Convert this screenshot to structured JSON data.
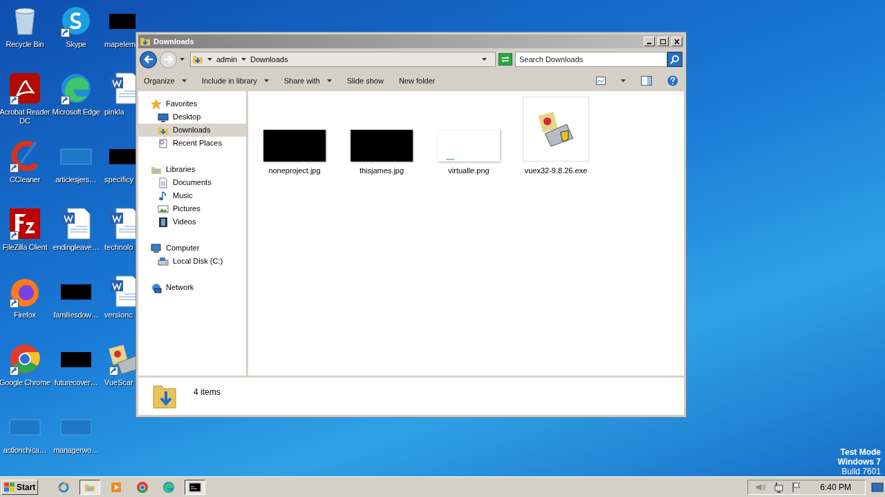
{
  "desktop": {
    "icons": [
      {
        "label": "Recycle Bin",
        "kind": "recycle",
        "shortcut": false
      },
      {
        "label": "Skype",
        "kind": "skype",
        "shortcut": true
      },
      {
        "label": "mapelem",
        "kind": "dark",
        "shortcut": false
      },
      {
        "label": "Acrobat Reader DC",
        "kind": "acrobat",
        "shortcut": true
      },
      {
        "label": "Microsoft Edge",
        "kind": "edge",
        "shortcut": true
      },
      {
        "label": "pinkla",
        "kind": "word",
        "shortcut": false
      },
      {
        "label": "CCleaner",
        "kind": "ccleaner",
        "shortcut": true
      },
      {
        "label": "articlesjers…",
        "kind": "blank",
        "shortcut": false
      },
      {
        "label": "specificy",
        "kind": "dark",
        "shortcut": false
      },
      {
        "label": "FileZilla Client",
        "kind": "filezilla",
        "shortcut": true
      },
      {
        "label": "endingleave…",
        "kind": "word",
        "shortcut": false
      },
      {
        "label": "technolo",
        "kind": "word",
        "shortcut": false
      },
      {
        "label": "Firefox",
        "kind": "firefox",
        "shortcut": true
      },
      {
        "label": "familiesdow…",
        "kind": "dark",
        "shortcut": false
      },
      {
        "label": "versionc",
        "kind": "word",
        "shortcut": false
      },
      {
        "label": "Google Chrome",
        "kind": "chrome",
        "shortcut": true
      },
      {
        "label": "futurecover…",
        "kind": "dark",
        "shortcut": false
      },
      {
        "label": "VueScar",
        "kind": "vuescan",
        "shortcut": true
      },
      {
        "label": "actionchica…",
        "kind": "blank",
        "shortcut": false
      },
      {
        "label": "managerwo…",
        "kind": "blank",
        "shortcut": false
      }
    ],
    "system_text": [
      "Test Mode",
      "Windows 7",
      "Build 7601"
    ]
  },
  "window": {
    "title": "Downloads",
    "breadcrumb": [
      "admin",
      "Downloads"
    ],
    "search": {
      "placeholder": "Search Downloads"
    },
    "toolbar": [
      {
        "label": "Organize",
        "dropdown": true
      },
      {
        "label": "Include in library",
        "dropdown": true
      },
      {
        "label": "Share with",
        "dropdown": true
      },
      {
        "label": "Slide show",
        "dropdown": false
      },
      {
        "label": "New folder",
        "dropdown": false
      }
    ],
    "nav": [
      {
        "label": "Favorites",
        "kind": "star",
        "selected": false,
        "children": [
          {
            "label": "Desktop",
            "kind": "desktop",
            "selected": false
          },
          {
            "label": "Downloads",
            "kind": "downloads",
            "selected": true
          },
          {
            "label": "Recent Places",
            "kind": "recent",
            "selected": false
          }
        ]
      },
      {
        "label": "Libraries",
        "kind": "library",
        "selected": false,
        "children": [
          {
            "label": "Documents",
            "kind": "documents",
            "selected": false
          },
          {
            "label": "Music",
            "kind": "music",
            "selected": false
          },
          {
            "label": "Pictures",
            "kind": "pictures",
            "selected": false
          },
          {
            "label": "Videos",
            "kind": "videos",
            "selected": false
          }
        ]
      },
      {
        "label": "Computer",
        "kind": "computer",
        "selected": false,
        "children": [
          {
            "label": "Local Disk (C:)",
            "kind": "disk",
            "selected": false
          }
        ]
      },
      {
        "label": "Network",
        "kind": "network",
        "selected": false
      }
    ],
    "files": [
      {
        "name": "noneproject.jpg",
        "kind": "dark"
      },
      {
        "name": "thisjames.jpg",
        "kind": "dark"
      },
      {
        "name": "virtualle.png",
        "kind": "light"
      },
      {
        "name": "vuex32-9.8.26.exe",
        "kind": "app"
      }
    ],
    "status": "4 items"
  },
  "taskbar": {
    "start": "Start",
    "apps": [
      {
        "kind": "ie",
        "active": false
      },
      {
        "kind": "explorer",
        "active": true
      },
      {
        "kind": "media",
        "active": false
      },
      {
        "kind": "chrome",
        "active": false
      },
      {
        "kind": "edge",
        "active": false
      },
      {
        "kind": "cmd",
        "active": true
      }
    ],
    "clock": "6:40 PM"
  }
}
